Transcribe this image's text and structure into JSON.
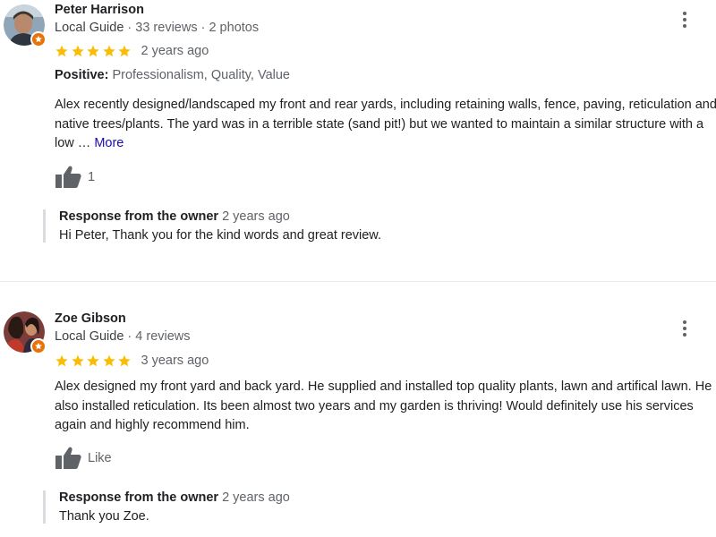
{
  "reviews": [
    {
      "name": "Peter Harrison",
      "guide_label": "Local Guide",
      "stats": " · 33 reviews · 2 photos",
      "rating": 5,
      "age": "2 years ago",
      "highlights_label": "Positive:",
      "highlights": " Professionalism, Quality, Value",
      "text": "Alex recently designed/landscaped my front and rear yards, including retaining walls, fence, paving, reticulation and native trees/plants. The yard was in a terrible state (sand pit!) but we wanted to maintain a similar structure with a low … ",
      "more_label": "More",
      "like_label": "1",
      "response_title": "Response from the owner",
      "response_age": "2 years ago",
      "response_text": "Hi Peter, Thank you for the kind words and great review."
    },
    {
      "name": "Zoe Gibson",
      "guide_label": "Local Guide",
      "stats": " · 4 reviews",
      "rating": 5,
      "age": "3 years ago",
      "text": "Alex designed my front yard and back yard. He supplied and installed top quality plants, lawn and artifical lawn. He also installed reticulation. Its been almost two years and my garden is thriving! Would definitely use his services again and highly recommend him.",
      "like_label": "Like",
      "response_title": "Response from the owner",
      "response_age": "2 years ago",
      "response_text": "Thank you Zoe."
    }
  ],
  "colors": {
    "star": "#fbbc04",
    "badge": "#e8710a",
    "link": "#1a0dab",
    "muted": "#5f6368"
  },
  "icons": [
    "local-guide-badge-icon",
    "star-icon",
    "thumbs-up-icon",
    "more-vert-icon"
  ]
}
